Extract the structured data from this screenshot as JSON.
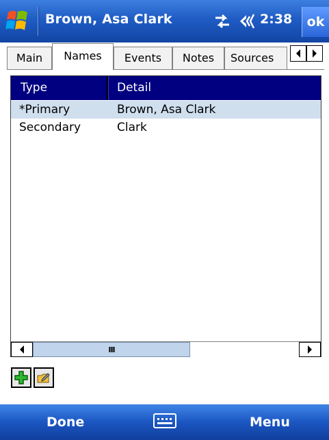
{
  "titlebar": {
    "title": "Brown, Asa Clark",
    "time": "2:38",
    "ok_label": "ok",
    "icons": [
      "windows-start-icon",
      "connectivity-icon",
      "volume-icon"
    ]
  },
  "tabs": [
    {
      "label": "Main",
      "active": false
    },
    {
      "label": "Names",
      "active": true
    },
    {
      "label": "Events",
      "active": false
    },
    {
      "label": "Notes",
      "active": false
    },
    {
      "label": "Sources",
      "active": false
    }
  ],
  "list": {
    "columns": [
      "Type",
      "Detail"
    ],
    "rows": [
      {
        "type": "*Primary",
        "detail": "Brown, Asa Clark",
        "selected": true
      },
      {
        "type": "Secondary",
        "detail": "Clark",
        "selected": false
      }
    ],
    "header_color": "#000080",
    "selected_color": "#cfdfee"
  },
  "scrollbar": {
    "thumb_glyph": "III"
  },
  "toolbar": {
    "buttons": [
      "add-icon",
      "edit-folder-icon"
    ]
  },
  "softkeys": {
    "left": "Done",
    "right": "Menu",
    "center_icon": "keyboard-icon"
  },
  "colors": {
    "titlebar": "#1f5cc4",
    "softbar": "#1b56c2"
  }
}
